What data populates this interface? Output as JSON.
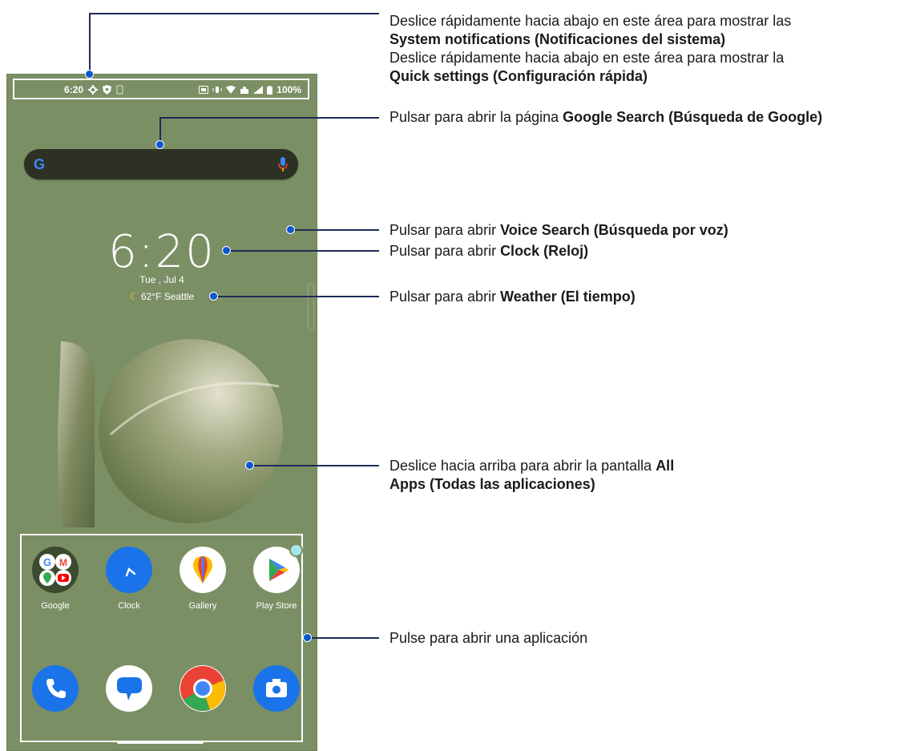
{
  "statusbar": {
    "time": "6:20",
    "battery": "100%"
  },
  "home": {
    "clock_time": "6:20",
    "date": "Tue , Jul 4",
    "weather": "62°F  Seattle",
    "search_logo": "G"
  },
  "dock": {
    "row1": [
      {
        "label": "Google",
        "icon": "google-folder-icon"
      },
      {
        "label": "Clock",
        "icon": "clock-icon"
      },
      {
        "label": "Gallery",
        "icon": "gallery-icon"
      },
      {
        "label": "Play Store",
        "icon": "play-store-icon"
      }
    ],
    "row2": [
      {
        "icon": "phone-icon"
      },
      {
        "icon": "messages-icon"
      },
      {
        "icon": "chrome-icon"
      },
      {
        "icon": "camera-icon"
      }
    ]
  },
  "annotations": {
    "notif_line1": "Deslice rápidamente hacia abajo en este área para mostrar las",
    "notif_line2": "System notifications (Notificaciones del sistema)",
    "quick_line1": "Deslice rápidamente hacia abajo en este área para mostrar la",
    "quick_line2": "Quick settings (Configuración rápida)",
    "search_pre": "Pulsar para abrir la página ",
    "search_bold": "Google Search (Búsqueda de Google)",
    "voice_pre": "Pulsar para abrir ",
    "voice_bold": "Voice Search (Búsqueda por voz)",
    "clock_pre": "Pulsar para abrir ",
    "clock_bold": "Clock (Reloj)",
    "weather_pre": "Pulsar para abrir ",
    "weather_bold": "Weather (El tiempo)",
    "allapps_pre": "Deslice hacia arriba para abrir la pantalla ",
    "allapps_bold1": "All",
    "allapps_bold2": "Apps (Todas las aplicaciones)",
    "app_text": "Pulse para abrir una aplicación"
  },
  "colors": {
    "wallpaper": "#7b8f64",
    "leader": "#1f2a5a",
    "dot": "#0b57d0"
  }
}
